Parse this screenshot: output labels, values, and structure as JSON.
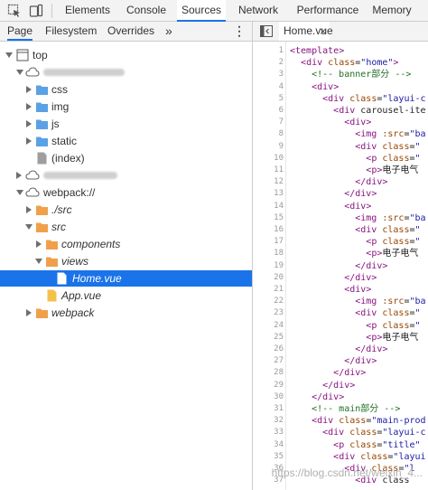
{
  "toolbar": {
    "tabs": [
      "Elements",
      "Console",
      "Sources",
      "Network",
      "Performance",
      "Memory"
    ],
    "active_tab": "Sources",
    "inspect_icon": "inspect-element-icon",
    "device_icon": "device-toggle-icon"
  },
  "navigator": {
    "tabs": [
      "Page",
      "Filesystem",
      "Overrides"
    ],
    "active_tab": "Page",
    "more_label": "»",
    "menu_label": "⋮"
  },
  "tree": {
    "top": "top",
    "css": "css",
    "img": "img",
    "js": "js",
    "static": "static",
    "index": "(index)",
    "webpack": "webpack://",
    "src_dot": "./src",
    "src": "src",
    "components": "components",
    "views": "views",
    "home": "Home.vue",
    "app": "App.vue",
    "webpack_folder": "webpack"
  },
  "editor": {
    "tab_label": "Home.vue",
    "close_label": "×",
    "toggle_icon": "sidebar-toggle-icon",
    "line_numbers": [
      "1",
      "2",
      "3",
      "4",
      "5",
      "6",
      "7",
      "8",
      "9",
      "10",
      "11",
      "12",
      "13",
      "14",
      "15",
      "16",
      "17",
      "18",
      "19",
      "20",
      "21",
      "22",
      "23",
      "24",
      "25",
      "26",
      "27",
      "28",
      "29",
      "30",
      "31",
      "32",
      "33",
      "34",
      "35",
      "36",
      "37"
    ],
    "lines": [
      "<template>",
      "  <div class=\"home\">",
      "    <!-- banner部分 -->",
      "    <div>",
      "      <div class=\"layui-c",
      "        <div carousel-ite",
      "          <div>",
      "            <img :src=\"ba",
      "            <div class=\"",
      "              <p class=\"",
      "              <p>电子电气",
      "            </div>",
      "          </div>",
      "          <div>",
      "            <img :src=\"ba",
      "            <div class=\"",
      "              <p class=\"",
      "              <p>电子电气",
      "            </div>",
      "          </div>",
      "          <div>",
      "            <img :src=\"ba",
      "            <div class=\"",
      "              <p class=\"",
      "              <p>电子电气",
      "            </div>",
      "          </div>",
      "        </div>",
      "      </div>",
      "    </div>",
      "    <!-- main部分 -->",
      "    <div class=\"main-prod",
      "      <div class=\"layui-c",
      "        <p class=\"title\"",
      "        <div class=\"layui",
      "          <div class=\"l",
      "            <div class"
    ]
  },
  "watermark": "https://blog.csdn.net/weixin_4..."
}
